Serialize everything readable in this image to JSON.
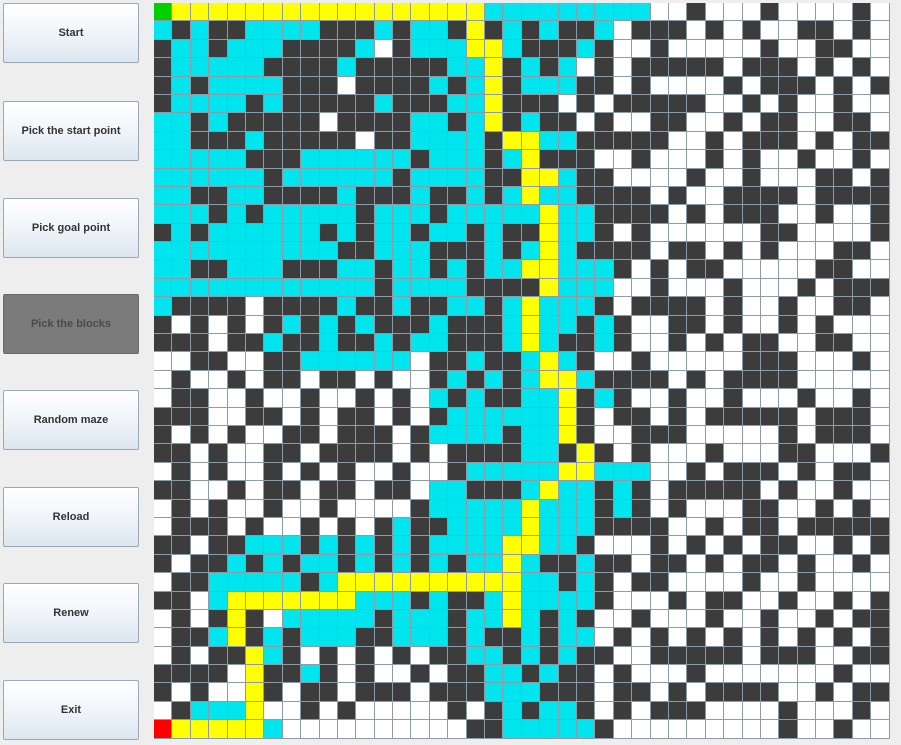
{
  "buttons": {
    "start": "Start",
    "pick_start": "Pick the start point",
    "pick_goal": "Pick goal point",
    "pick_blocks": "Pick the blocks",
    "random_maze": "Random maze",
    "reload": "Reload",
    "renew": "Renew",
    "exit": "Exit"
  },
  "colors": {
    "empty": "#ffffff",
    "wall": "#3c3c3c",
    "visited": "#00e5ee",
    "path": "#ffff00",
    "start": "#00d000",
    "goal": "#ff0000",
    "gridline": "#8d9aa8"
  },
  "maze": {
    "legend": "S=start G=goal P=path C=visited #=wall .=empty",
    "rows": [
      "SPPPPPPPPPPPPPPPPPCCCCCCCCC..#...#....#.",
      "C#C##CCCC###C#CC#P#C#C##C.###.#.#..##.#.",
      "#CC#CCC####C.#CCCPPC###C#..#.....#..##..",
      "#CCCCC####C#####CCP#C#C.#.#####.###.#.#.",
      "#C#CCCC###.####C#CP#CCC##.#....#.###.#.#",
      "#CCCC#C#####C###CCP###.#.#####..#.#..#..",
      "CC#C#####.####CC#CP#C##.#..##..#.##..##.",
      "CC###C#####.##CCCC#PPCC#####..#.###.#.##",
      "CCCCC###CCCCCC#CCC#CP###..#...#.#..#..#.",
      "CCCCCC#CCCCCC#CCCC##PPC##....#..#...##.#",
      "CC##CC####C###C##C#CPCC####.#..####.####",
      "CCC#C#CCCCC#CCC#CCCCCPCC####.#.###..#..#",
      "#C#CCCCCC#C#CC#CC#C##PCC#.#......##....#",
      "CCCCCCCCCC##CCC###C#CPC####.##.#.#...##.",
      "CC##CCC###CC#CC#C#CCPPCCC#.#.##.....##..",
      "CCCCCCCCCCCC#CCCC####PCCC..#...#...#.###",
      "C####.####C##C##CC#CPCCC#.####.#..#..##.",
      "#.#.#.#C#C#C###C###CPCC#C#..##.#..#.#...",
      "###.##C##C##C#CC###CPC##C#..#.#.##..##..",
      "..##..##CCCCCC.##C##CPC#..#.....###...#.",
      ".#..#.##.##.#..#C#C#CPPC####.#.####.....",
      ".##..#..#..#.#.C#C##CCP#C#..#..#...#..#.",
      "###..##.#.##.#.#CCCCCCP#.##.#.#####.###.",
      "#.#.#..##.###.#CCCC#CCP#..###.....#.###.",
      "##.#..##.####.#.####CC#P#.#...#...##...#",
      ".#.#..#.#.#..#..#CCCCCPPCCC..#.###.#.##.",
      "##..#.##.##.##.CC###CPCC#C#.#####.#..#..",
      ".#.#..#..#....#CCCCCPCCC#C#.#...##..#.#.",
      ".###.#..#.#.#C##CCCCPCCC####..#.##.#####",
      "##.##CCC#C#C#C#CCCCPPCC#...#.#.#.##..#.#",
      "#.##C#C#CC#C#C#C#CCPC##C##.##.#.##.#..#.",
      ".##CCCCC#CPPPPPPPPPPCC#C#.##....#..#....",
      "##.CPPPPPPPCCC#C##CPCCCC#...#.##..#..#.#",
      ".#.#P#.CCCCC#CCC#CCPC#C#..#...#..#..#.##",
      ".##CP#C#CCC##CCC#C##C#CC.#.#.#.#.#.#.#.#",
      ".#.##PC#.#.#.#.##CC#C#C##..#####.###..##",
      "####.P##C#.#..#.##CC#C##.#...#.......#..",
      "#.#..P#.##.###.###CCC###.##.#.####..#.##",
      ".#CCCP..#.#.....#.#C#CC#.#.###....#...#.",
      "GPPPPPC..........##CCCCC#.........#..#.."
    ]
  }
}
